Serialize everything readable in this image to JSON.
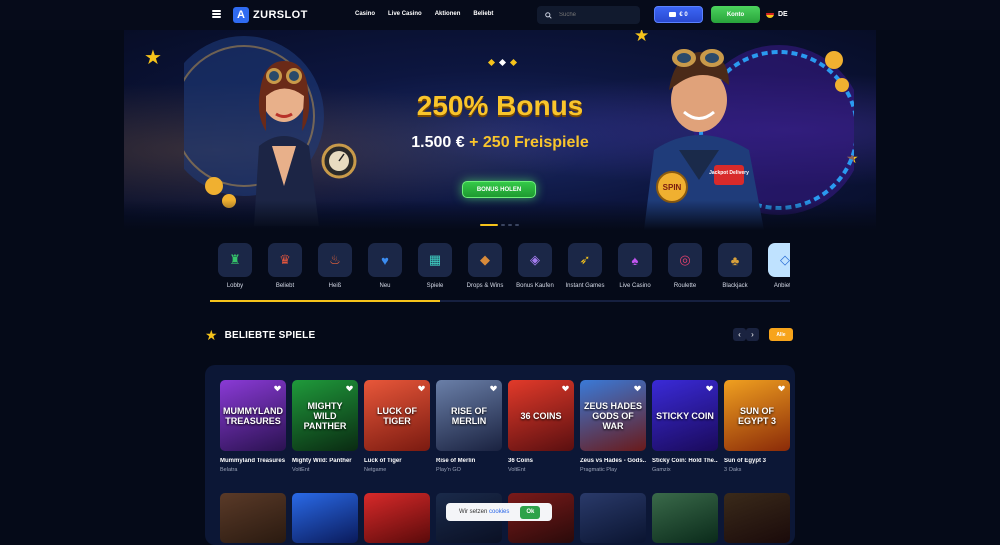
{
  "header": {
    "brand": "ZURSLOT",
    "brand_mark": "A",
    "nav": [
      "Casino",
      "Live Casino",
      "Aktionen",
      "Beliebt"
    ],
    "search_placeholder": "Suche",
    "balance": "€ 0",
    "account_label": "Konto",
    "language": "DE"
  },
  "hero": {
    "title": "250% Bonus",
    "subtitle_amount": "1.500 €",
    "subtitle_rest": " + 250 Freispiele",
    "cta": "BONUS HOLEN",
    "slides_total": 4,
    "slide_active": 1,
    "badge_spin": "SPIN",
    "badge_jackpot": "Jackpot Delivery"
  },
  "categories": [
    {
      "label": "Lobby",
      "icon": "lobby-icon",
      "glyph": "♜",
      "color": "#35c46a"
    },
    {
      "label": "Beliebt",
      "icon": "crown-icon",
      "glyph": "♛",
      "color": "#e2553d"
    },
    {
      "label": "Heiß",
      "icon": "flame-icon",
      "glyph": "♨",
      "color": "#f1663a"
    },
    {
      "label": "Neu",
      "icon": "new-icon",
      "glyph": "♥",
      "color": "#3b8cf0"
    },
    {
      "label": "Spiele",
      "icon": "slots-icon",
      "glyph": "▦",
      "color": "#3fd0c3"
    },
    {
      "label": "Drops & Wins",
      "icon": "drops-icon",
      "glyph": "◆",
      "color": "#d88a3a"
    },
    {
      "label": "Bonus Kaufen",
      "icon": "bonus-buy-icon",
      "glyph": "◈",
      "color": "#a57cf0"
    },
    {
      "label": "Instant Games",
      "icon": "rocket-icon",
      "glyph": "➶",
      "color": "#f6c31b"
    },
    {
      "label": "Live Casino",
      "icon": "live-casino-icon",
      "glyph": "♠",
      "color": "#c155f0"
    },
    {
      "label": "Roulette",
      "icon": "roulette-icon",
      "glyph": "◎",
      "color": "#e2416e"
    },
    {
      "label": "Blackjack",
      "icon": "blackjack-icon",
      "glyph": "♣",
      "color": "#d8a03a"
    },
    {
      "label": "Anbieter",
      "icon": "providers-icon",
      "glyph": "◇",
      "color": "#2c6fd6"
    }
  ],
  "popular": {
    "title": "BELIEBTE SPIELE",
    "all_label": "Alle",
    "games": [
      {
        "name": "Mummyland Treasures",
        "provider": "Belatra",
        "art": "MUMMYLAND TREASURES",
        "c1": "#8a3ad6",
        "c2": "#2a1250"
      },
      {
        "name": "Mighty Wild: Panther",
        "provider": "VoltEnt",
        "art": "MIGHTY WILD PANTHER",
        "c1": "#1f9a3b",
        "c2": "#0a2a12"
      },
      {
        "name": "Luck of Tiger",
        "provider": "Netgame",
        "art": "LUCK OF TIGER",
        "c1": "#e8573a",
        "c2": "#7a1a10"
      },
      {
        "name": "Rise of Merlin",
        "provider": "Play'n GO",
        "art": "RISE OF MERLIN",
        "c1": "#6a7fa8",
        "c2": "#1a2240"
      },
      {
        "name": "36 Coins",
        "provider": "VoltEnt",
        "art": "36 COINS",
        "c1": "#e23a2a",
        "c2": "#5a0f10"
      },
      {
        "name": "Zeus vs Hades - Gods...",
        "provider": "Pragmatic Play",
        "art": "ZEUS HADES GODS OF WAR",
        "c1": "#3a7ad8",
        "c2": "#6a1a1a"
      },
      {
        "name": "Sticky Coin: Hold The...",
        "provider": "Gamzix",
        "art": "STICKY COIN",
        "c1": "#3a2ad8",
        "c2": "#1a0a5a"
      },
      {
        "name": "Sun of Egypt 3",
        "provider": "3 Oaks",
        "art": "SUN OF EGYPT 3",
        "c1": "#f0a020",
        "c2": "#8a2a08"
      }
    ],
    "row2_colors": [
      [
        "#5a3a28",
        "#2a1a10"
      ],
      [
        "#2a6ae8",
        "#0a1a5a"
      ],
      [
        "#d82a2a",
        "#5a0a0a"
      ],
      [
        "#1a2a4a",
        "#0a1024"
      ],
      [
        "#7a1a1a",
        "#2a0a0a"
      ],
      [
        "#2a3a6a",
        "#0a1430"
      ],
      [
        "#3a6a4a",
        "#0a2a1a"
      ],
      [
        "#3a2a1a",
        "#1a0a0a"
      ]
    ]
  },
  "cookie": {
    "text": "Wir setzen",
    "link": "cookies",
    "button": "Ok"
  },
  "colors": {
    "accent_gold": "#f6c31b",
    "deposit_blue": "#3c66f5",
    "account_green": "#34c948",
    "background": "#050a18"
  }
}
